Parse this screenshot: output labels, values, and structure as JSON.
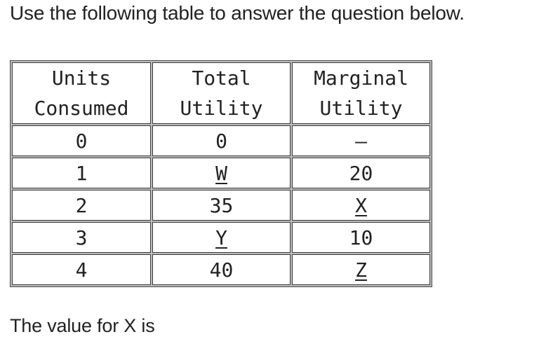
{
  "intro": "Use the following table to answer the question below.",
  "table": {
    "headers": [
      {
        "line1": "Units",
        "line2": "Consumed"
      },
      {
        "line1": "Total",
        "line2": "Utility"
      },
      {
        "line1": "Marginal",
        "line2": "Utility"
      }
    ],
    "rows": [
      {
        "units": "0",
        "total": "0",
        "marginal": "–"
      },
      {
        "units": "1",
        "total": "W",
        "marginal": "20"
      },
      {
        "units": "2",
        "total": "35",
        "marginal": "X"
      },
      {
        "units": "3",
        "total": "Y",
        "marginal": "10"
      },
      {
        "units": "4",
        "total": "40",
        "marginal": "Z"
      }
    ]
  },
  "question": "The value for X is"
}
